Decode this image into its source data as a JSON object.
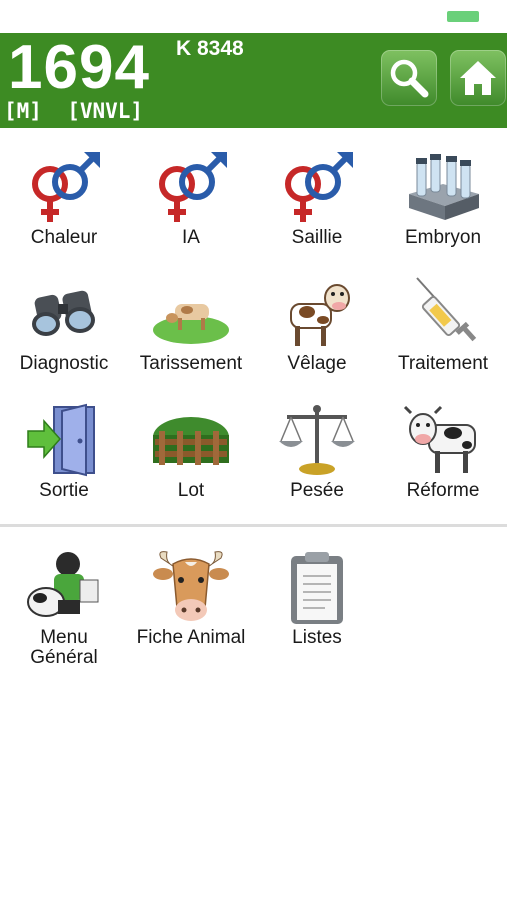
{
  "header": {
    "animal_number": "1694",
    "animal_code": "K 8348",
    "tags": "[M]  [VNVL]"
  },
  "actions": {
    "chaleur": "Chaleur",
    "ia": "IA",
    "saillie": "Saillie",
    "embryon": "Embryon",
    "diagnostic": "Diagnostic",
    "tarissement": "Tarissement",
    "velage": "Vêlage",
    "traitement": "Traitement",
    "sortie": "Sortie",
    "lot": "Lot",
    "pesee": "Pesée",
    "reforme": "Réforme"
  },
  "navigation": {
    "menu_general_line1": "Menu",
    "menu_general_line2": "Général",
    "fiche_animal": "Fiche Animal",
    "listes": "Listes"
  },
  "icons": {
    "header": [
      "search-icon",
      "home-icon"
    ],
    "actions": [
      "gender-symbols-icon",
      "gender-symbols-icon",
      "gender-symbols-icon",
      "test-tubes-icon",
      "binoculars-icon",
      "grazing-cow-icon",
      "cow-icon",
      "syringe-icon",
      "exit-door-icon",
      "fence-icon",
      "scale-icon",
      "cull-cow-icon"
    ],
    "navigation": [
      "farmer-icon",
      "cow-head-icon",
      "clipboard-icon"
    ]
  },
  "colors": {
    "header_bg": "#3d8b23",
    "button_bg": "#5ea843",
    "battery": "#6ad07a"
  }
}
